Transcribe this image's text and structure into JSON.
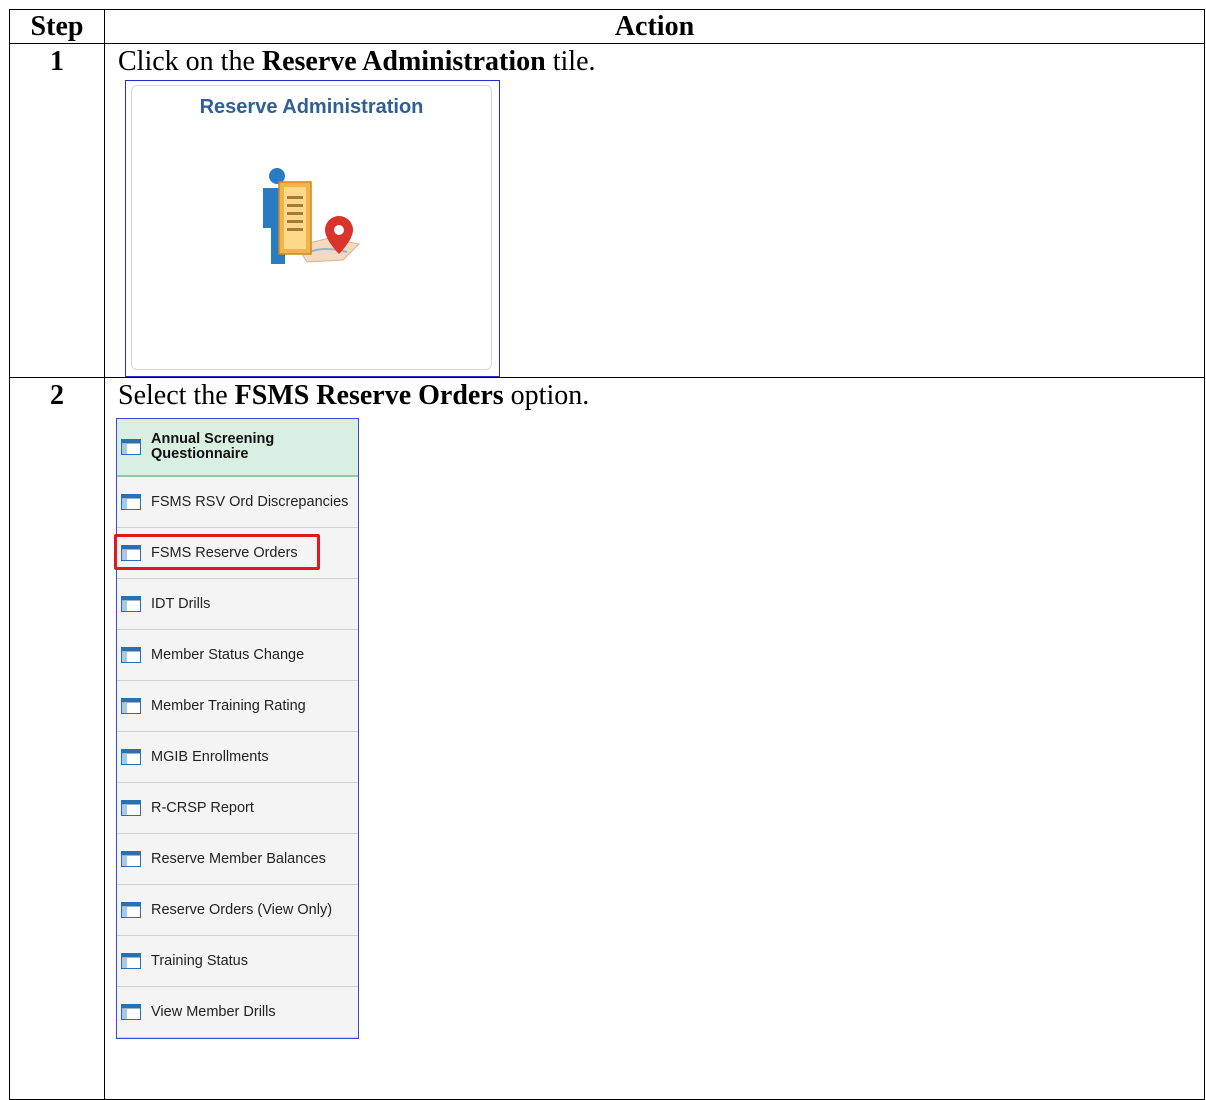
{
  "table": {
    "header_step": "Step",
    "header_action": "Action"
  },
  "steps": [
    {
      "number": "1",
      "text_before": "Click on the ",
      "text_bold": "Reserve Administration",
      "text_after": " tile.",
      "tile": {
        "title": "Reserve Administration",
        "icon": "person-document-map-pin-icon"
      }
    },
    {
      "number": "2",
      "text_before": "Select the ",
      "text_bold": "FSMS Reserve Orders",
      "text_after": " option.",
      "menu": {
        "header": "Annual Screening Questionnaire",
        "items": [
          "FSMS RSV Ord Discrepancies",
          "FSMS Reserve Orders",
          "IDT Drills",
          "Member Status Change",
          "Member Training Rating",
          "MGIB Enrollments",
          "R-CRSP Report",
          "Reserve Member Balances",
          "Reserve Orders (View Only)",
          "Training Status",
          "View Member Drills"
        ],
        "highlighted_index": 1,
        "highlight_color": "#e0191e",
        "item_icon": "component-page-icon"
      }
    }
  ]
}
